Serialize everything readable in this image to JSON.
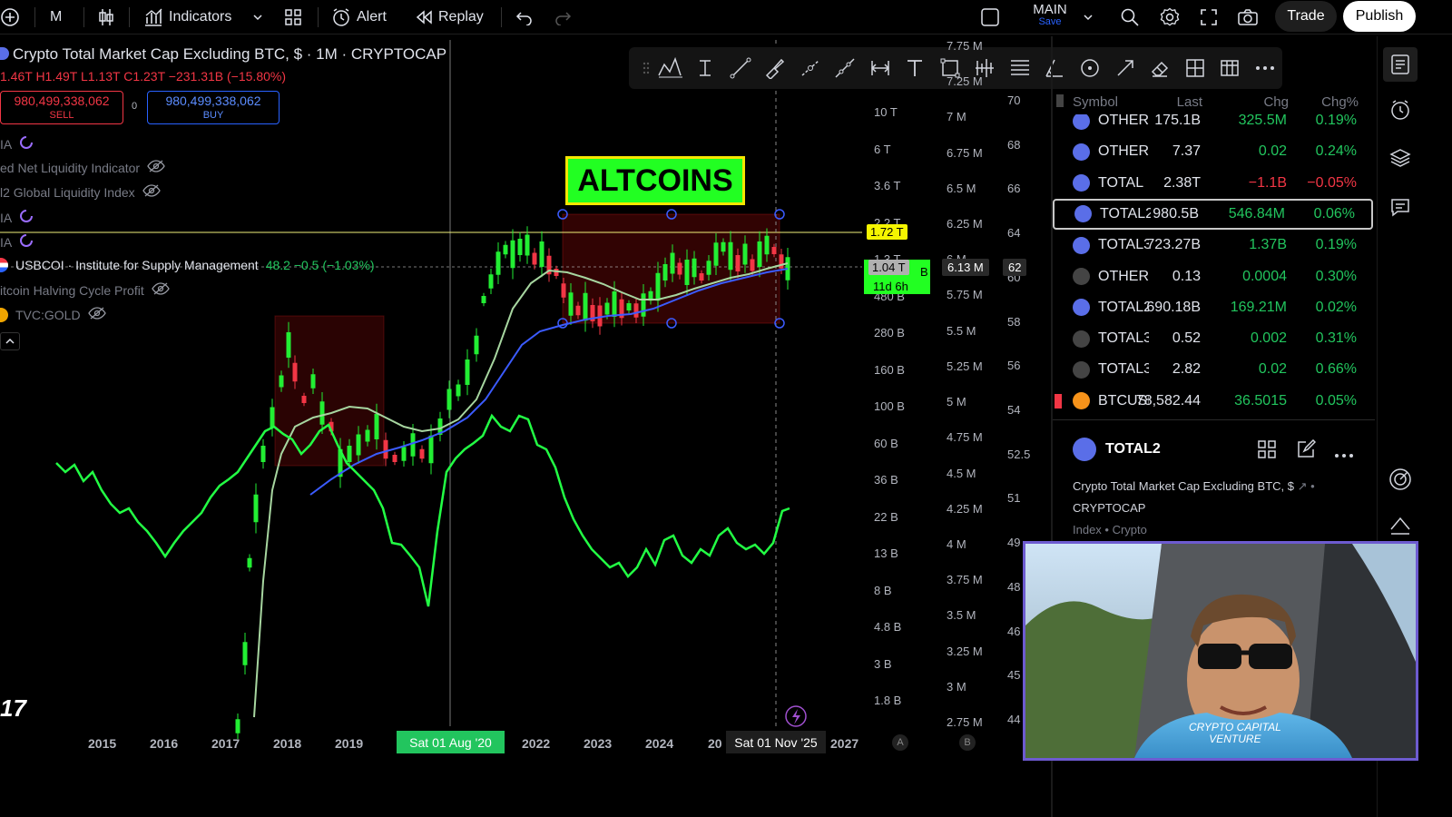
{
  "toolbar": {
    "interval": "M",
    "indicators_label": "Indicators",
    "alert_label": "Alert",
    "replay_label": "Replay",
    "layout_name": "MAIN",
    "layout_sub": "Save",
    "trade_label": "Trade",
    "publish_label": "Publish"
  },
  "legend": {
    "title": "Crypto Total Market Cap Excluding BTC, $ · 1M · CRYPTOCAP",
    "ohlc": [
      "1.46T",
      "H1.49T",
      "L1.13T",
      "C1.23T",
      "−231.31B (−15.80%)"
    ],
    "sell_value": "980,499,338,062",
    "sell_label": "SELL",
    "spread": "0",
    "buy_value": "980,499,338,062",
    "buy_label": "BUY"
  },
  "indicators": [
    {
      "label": "IA"
    },
    {
      "label": "ed Net Liquidity Indicator"
    },
    {
      "label": "l2 Global Liquidity Index"
    },
    {
      "label": "IA"
    },
    {
      "label": "IA"
    },
    {
      "label": "USBCOI · Institute for Supply Management",
      "value": "48.2  −0.5 (−1.03%)"
    },
    {
      "label": "itcoin Halving Cycle Profit"
    },
    {
      "label": "TVC:GOLD"
    }
  ],
  "annotation": {
    "text": "ALTCOINS"
  },
  "price_scale_left": [
    "10 T",
    "6 T",
    "3.6 T",
    "2.2 T",
    "1.3 T",
    "480 B",
    "280 B",
    "160 B",
    "100 B",
    "60 B",
    "36 B",
    "22 B",
    "13 B",
    "8 B",
    "4.8 B",
    "3 B",
    "1.8 B"
  ],
  "price_scale_mid": [
    "7.75 M",
    "7.25 M",
    "7 M",
    "6.75 M",
    "6.5 M",
    "6.25 M",
    "6 M",
    "5.75 M",
    "5.5 M",
    "5.25 M",
    "5 M",
    "4.75 M",
    "4.5 M",
    "4.25 M",
    "4 M",
    "3.75 M",
    "3.5 M",
    "3.25 M",
    "3 M",
    "2.75 M"
  ],
  "price_scale_right": [
    "70",
    "68",
    "66",
    "64",
    "60",
    "58",
    "56",
    "54",
    "52.5",
    "51",
    "49",
    "48",
    "46",
    "45",
    "44"
  ],
  "price_tags": {
    "top": "1.72 T",
    "current": "1.04 T",
    "countdown": "11d 6h",
    "tag_b": "B",
    "mid": "6.13 M",
    "right": "62"
  },
  "x_axis": [
    "2015",
    "2016",
    "2017",
    "2018",
    "2019",
    "2022",
    "2023",
    "2024",
    "20",
    "2027"
  ],
  "x_cursor_left": "Sat 01 Aug '20",
  "x_cursor_right": "Sat 01 Nov '25",
  "x_markers": [
    "A",
    "B"
  ],
  "watchlist": {
    "headers": [
      "Symbol",
      "Last",
      "Chg",
      "Chg%"
    ],
    "rows": [
      {
        "sym": "OTHER",
        "last": "175.1B",
        "chg": "325.5M",
        "chgp": "0.19%",
        "dir": "g"
      },
      {
        "sym": "OTHER",
        "last": "7.37",
        "chg": "0.02",
        "chgp": "0.24%",
        "dir": "g"
      },
      {
        "sym": "TOTAL",
        "last": "2.38T",
        "chg": "−1.1B",
        "chgp": "−0.05%",
        "dir": "r"
      },
      {
        "sym": "TOTAL2",
        "last": "980.5B",
        "chg": "546.84M",
        "chgp": "0.06%",
        "dir": "g"
      },
      {
        "sym": "TOTAL3",
        "last": "723.27B",
        "chg": "1.37B",
        "chgp": "0.19%",
        "dir": "g"
      },
      {
        "sym": "OTHER",
        "last": "0.13",
        "chg": "0.0004",
        "chgp": "0.30%",
        "dir": "g"
      },
      {
        "sym": "TOTAL2",
        "last": "690.18B",
        "chg": "169.21M",
        "chgp": "0.02%",
        "dir": "g"
      },
      {
        "sym": "TOTAL3",
        "last": "0.52",
        "chg": "0.002",
        "chgp": "0.31%",
        "dir": "g"
      },
      {
        "sym": "TOTAL3",
        "last": "2.82",
        "chg": "0.02",
        "chgp": "0.66%",
        "dir": "g"
      },
      {
        "sym": "BTCUSD",
        "last": "78,582.44",
        "chg": "36.5015",
        "chgp": "0.05%",
        "dir": "g"
      }
    ]
  },
  "details": {
    "symbol": "TOTAL2",
    "description": "Crypto Total Market Cap Excluding BTC, $",
    "exchange": "CRYPTOCAP",
    "meta": "Index • Crypto"
  },
  "watermark": {
    "line1": "CRYPTO CAPITAL",
    "line2": "VENTURE"
  },
  "logo_mark": "17",
  "colors": {
    "accent_green": "#22ff44",
    "down_red": "#f23645",
    "indicator_blue": "#3b5bff",
    "webcam_border": "#6d5bd0"
  }
}
